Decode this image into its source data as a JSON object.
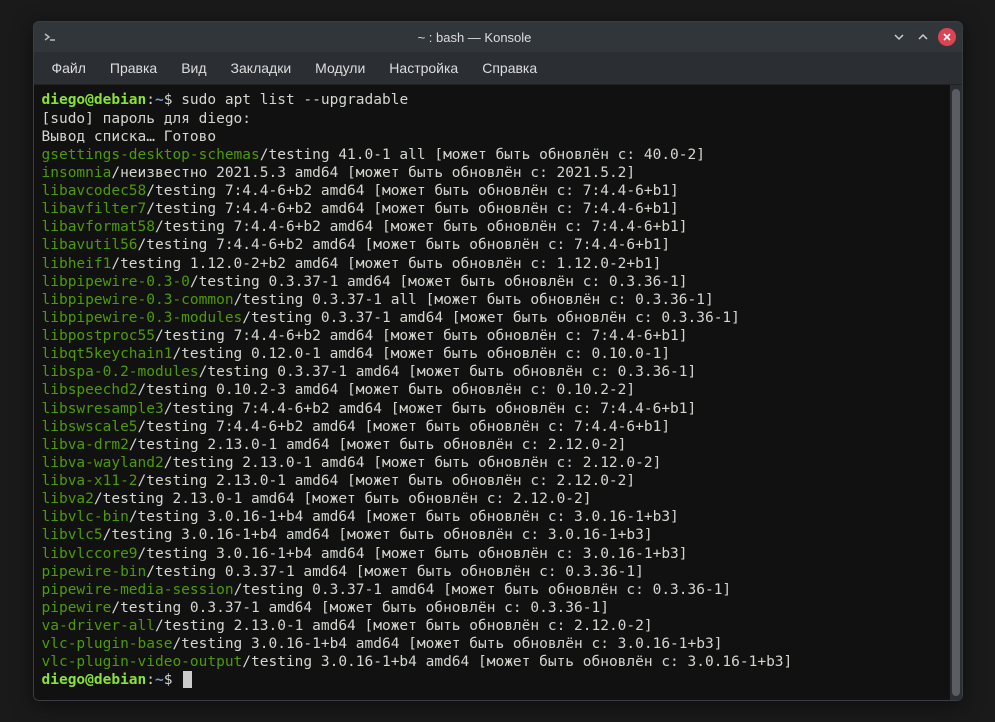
{
  "title": "~ : bash — Konsole",
  "menu": [
    "Файл",
    "Правка",
    "Вид",
    "Закладки",
    "Модули",
    "Настройка",
    "Справка"
  ],
  "prompt": {
    "userhost": "diego@debian",
    "sep1": ":",
    "path": "~",
    "sep2": "$ "
  },
  "command": "sudo apt list --upgradable",
  "sudo_line": "[sudo] пароль для diego:",
  "listing_line": "Вывод списка… Готово",
  "packages": [
    {
      "name": "gsettings-desktop-schemas",
      "rest": "/testing 41.0-1 all [может быть обновлён с: 40.0-2]"
    },
    {
      "name": "insomnia",
      "rest": "/неизвестно 2021.5.3 amd64 [может быть обновлён с: 2021.5.2]"
    },
    {
      "name": "libavcodec58",
      "rest": "/testing 7:4.4-6+b2 amd64 [может быть обновлён с: 7:4.4-6+b1]"
    },
    {
      "name": "libavfilter7",
      "rest": "/testing 7:4.4-6+b2 amd64 [может быть обновлён с: 7:4.4-6+b1]"
    },
    {
      "name": "libavformat58",
      "rest": "/testing 7:4.4-6+b2 amd64 [может быть обновлён с: 7:4.4-6+b1]"
    },
    {
      "name": "libavutil56",
      "rest": "/testing 7:4.4-6+b2 amd64 [может быть обновлён с: 7:4.4-6+b1]"
    },
    {
      "name": "libheif1",
      "rest": "/testing 1.12.0-2+b2 amd64 [может быть обновлён с: 1.12.0-2+b1]"
    },
    {
      "name": "libpipewire-0.3-0",
      "rest": "/testing 0.3.37-1 amd64 [может быть обновлён с: 0.3.36-1]"
    },
    {
      "name": "libpipewire-0.3-common",
      "rest": "/testing 0.3.37-1 all [может быть обновлён с: 0.3.36-1]"
    },
    {
      "name": "libpipewire-0.3-modules",
      "rest": "/testing 0.3.37-1 amd64 [может быть обновлён с: 0.3.36-1]"
    },
    {
      "name": "libpostproc55",
      "rest": "/testing 7:4.4-6+b2 amd64 [может быть обновлён с: 7:4.4-6+b1]"
    },
    {
      "name": "libqt5keychain1",
      "rest": "/testing 0.12.0-1 amd64 [может быть обновлён с: 0.10.0-1]"
    },
    {
      "name": "libspa-0.2-modules",
      "rest": "/testing 0.3.37-1 amd64 [может быть обновлён с: 0.3.36-1]"
    },
    {
      "name": "libspeechd2",
      "rest": "/testing 0.10.2-3 amd64 [может быть обновлён с: 0.10.2-2]"
    },
    {
      "name": "libswresample3",
      "rest": "/testing 7:4.4-6+b2 amd64 [может быть обновлён с: 7:4.4-6+b1]"
    },
    {
      "name": "libswscale5",
      "rest": "/testing 7:4.4-6+b2 amd64 [может быть обновлён с: 7:4.4-6+b1]"
    },
    {
      "name": "libva-drm2",
      "rest": "/testing 2.13.0-1 amd64 [может быть обновлён с: 2.12.0-2]"
    },
    {
      "name": "libva-wayland2",
      "rest": "/testing 2.13.0-1 amd64 [может быть обновлён с: 2.12.0-2]"
    },
    {
      "name": "libva-x11-2",
      "rest": "/testing 2.13.0-1 amd64 [может быть обновлён с: 2.12.0-2]"
    },
    {
      "name": "libva2",
      "rest": "/testing 2.13.0-1 amd64 [может быть обновлён с: 2.12.0-2]"
    },
    {
      "name": "libvlc-bin",
      "rest": "/testing 3.0.16-1+b4 amd64 [может быть обновлён с: 3.0.16-1+b3]"
    },
    {
      "name": "libvlc5",
      "rest": "/testing 3.0.16-1+b4 amd64 [может быть обновлён с: 3.0.16-1+b3]"
    },
    {
      "name": "libvlccore9",
      "rest": "/testing 3.0.16-1+b4 amd64 [может быть обновлён с: 3.0.16-1+b3]"
    },
    {
      "name": "pipewire-bin",
      "rest": "/testing 0.3.37-1 amd64 [может быть обновлён с: 0.3.36-1]"
    },
    {
      "name": "pipewire-media-session",
      "rest": "/testing 0.3.37-1 amd64 [может быть обновлён с: 0.3.36-1]"
    },
    {
      "name": "pipewire",
      "rest": "/testing 0.3.37-1 amd64 [может быть обновлён с: 0.3.36-1]"
    },
    {
      "name": "va-driver-all",
      "rest": "/testing 2.13.0-1 amd64 [может быть обновлён с: 2.12.0-2]"
    },
    {
      "name": "vlc-plugin-base",
      "rest": "/testing 3.0.16-1+b4 amd64 [может быть обновлён с: 3.0.16-1+b3]"
    },
    {
      "name": "vlc-plugin-video-output",
      "rest": "/testing 3.0.16-1+b4 amd64 [может быть обновлён с: 3.0.16-1+b3]"
    }
  ]
}
